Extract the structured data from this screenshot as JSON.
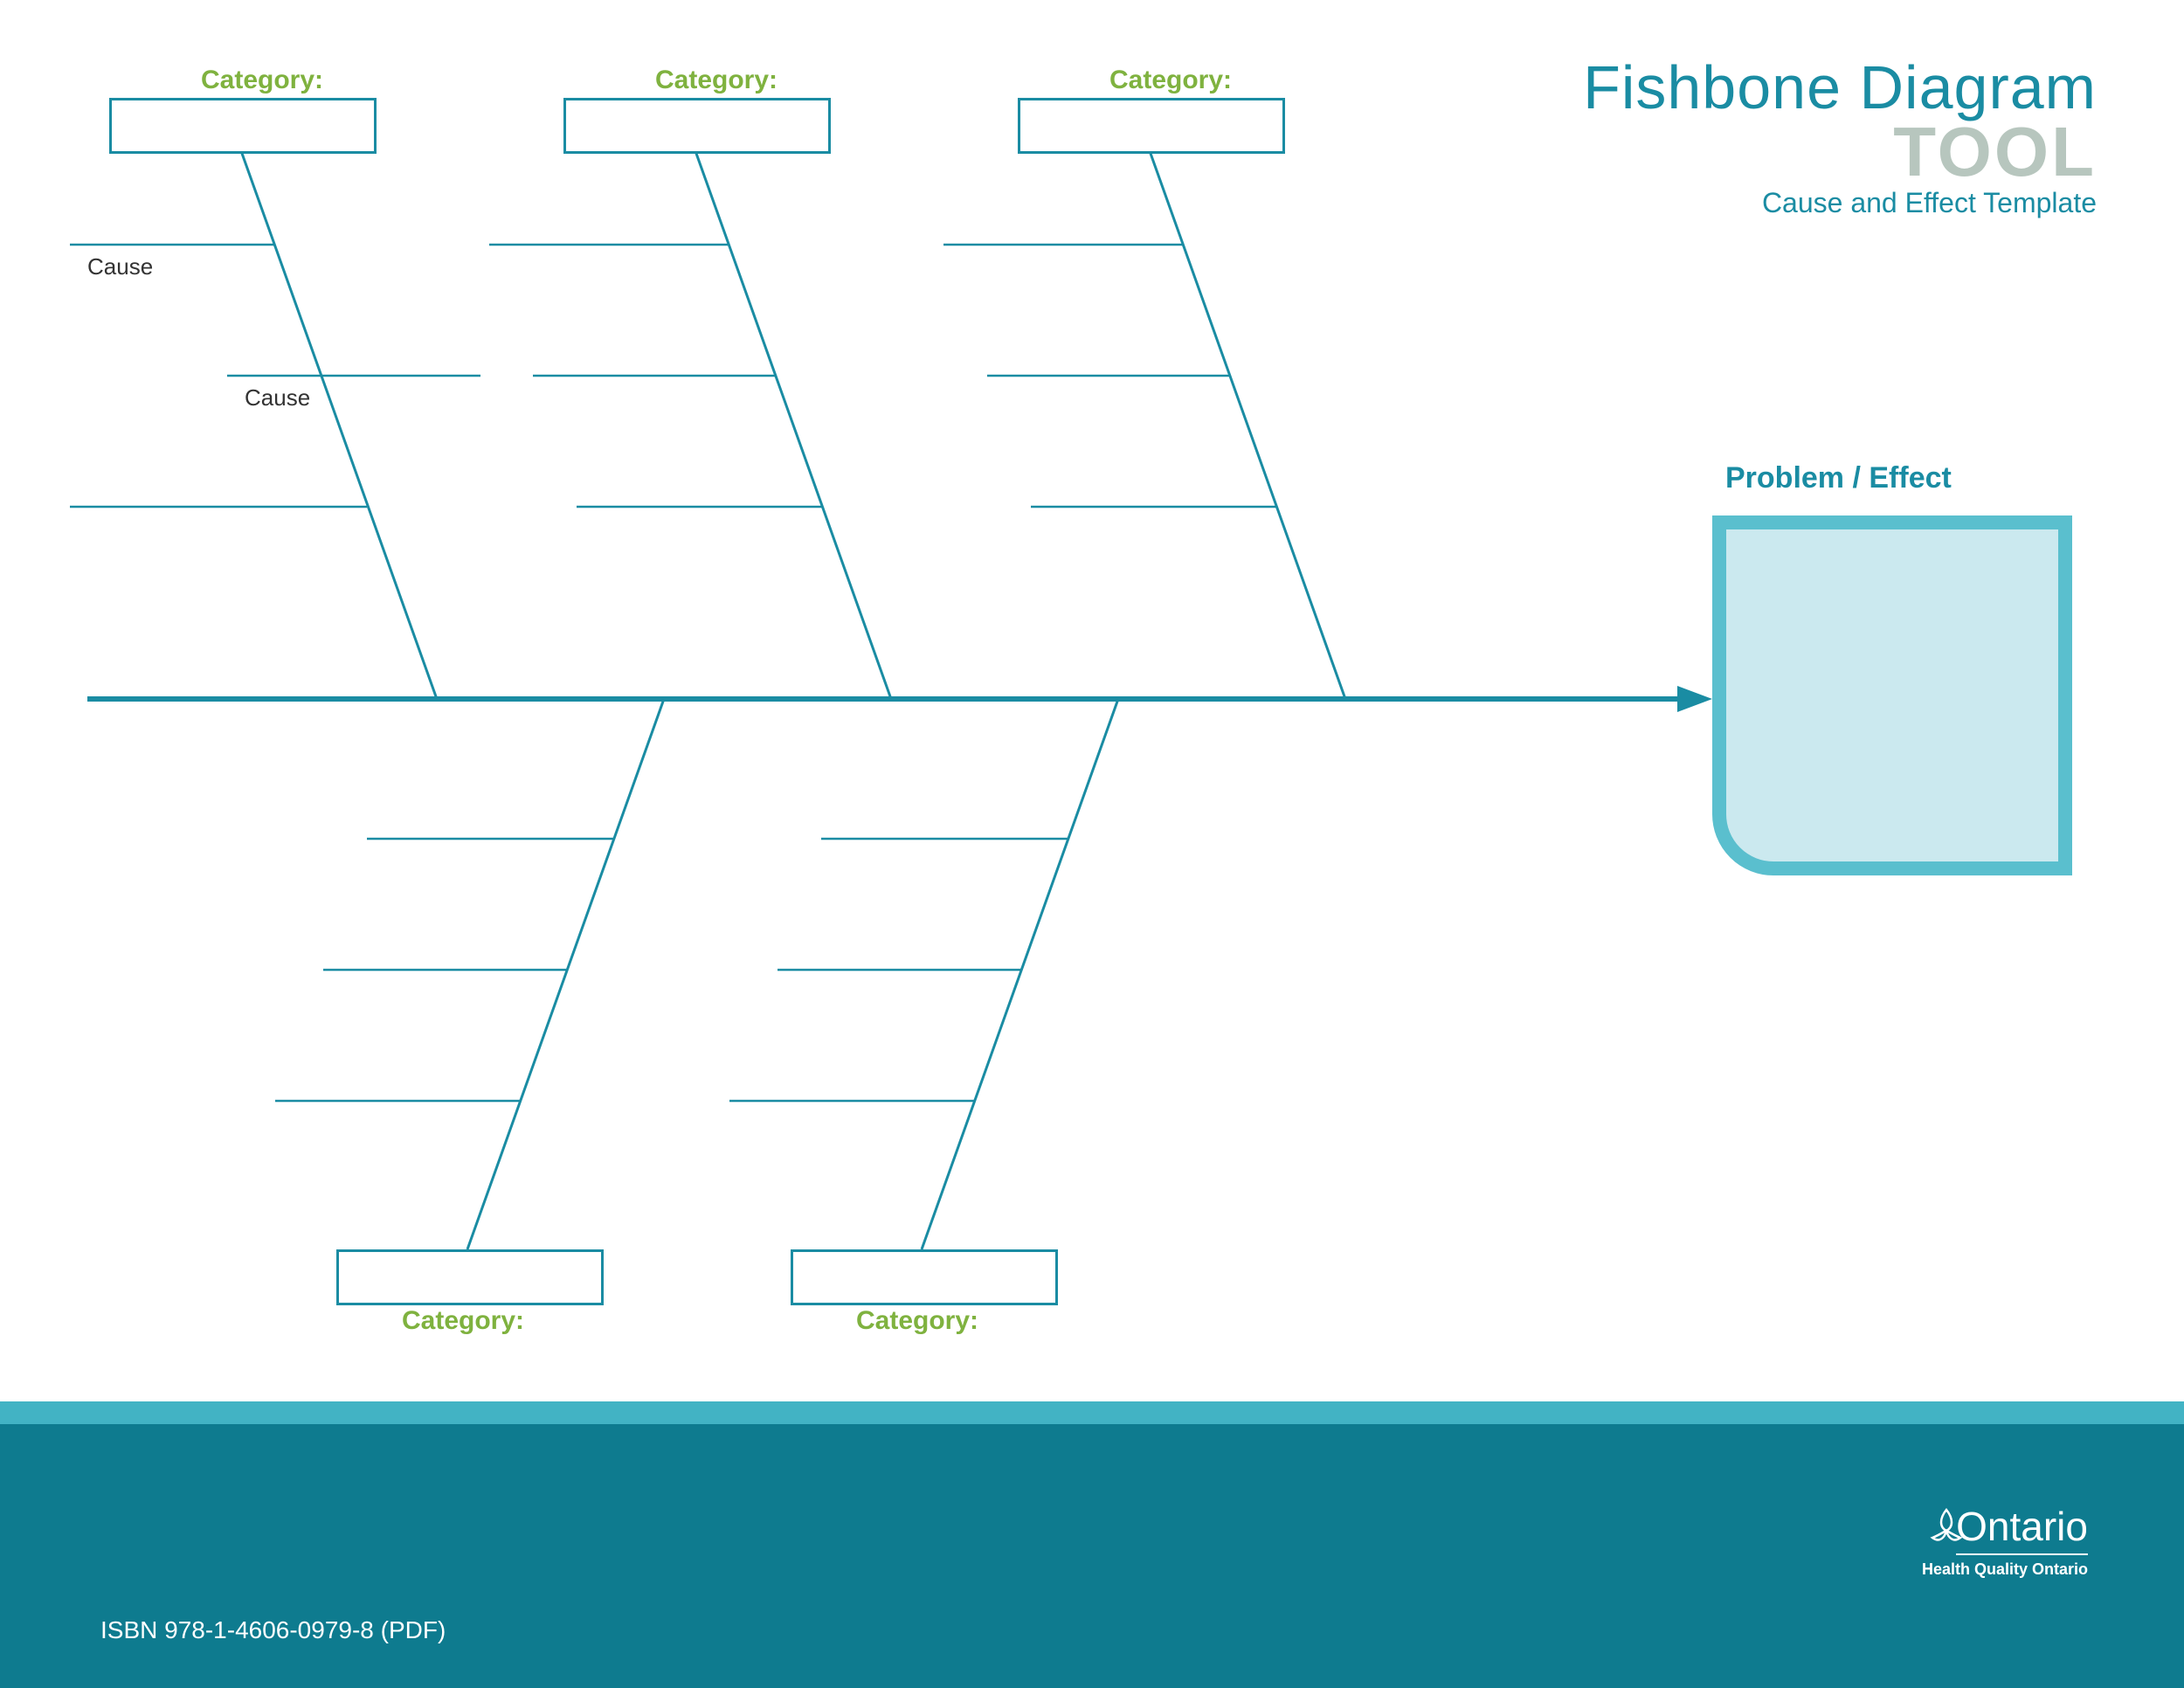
{
  "title": {
    "line1": "Fishbone Diagram",
    "line2": "TOOL",
    "subtitle": "Cause and Effect Template"
  },
  "problem": {
    "label": "Problem / Effect"
  },
  "categories": {
    "top1": "Category:",
    "top2": "Category:",
    "top3": "Category:",
    "bot1": "Category:",
    "bot2": "Category:"
  },
  "causes": {
    "c1": "Cause",
    "c2": "Cause"
  },
  "footer": {
    "isbn": "ISBN 978-1-4606-0979-8 (PDF)",
    "logo_name": "Ontario",
    "logo_sub": "Health Quality Ontario"
  },
  "colors": {
    "teal": "#1a8ca3",
    "green": "#7fb23f",
    "cyan": "#5abfce",
    "lightcyan": "#cbe9ef",
    "footer": "#0e7b8f"
  }
}
